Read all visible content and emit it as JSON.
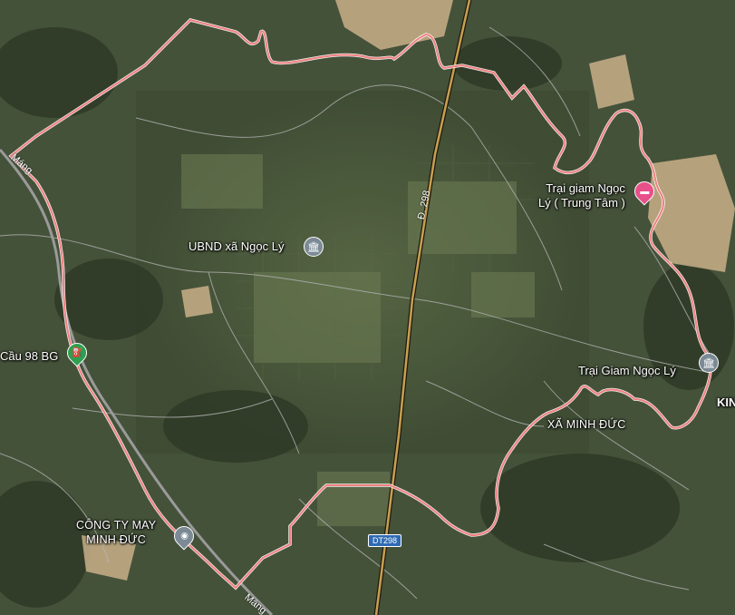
{
  "places": {
    "trai_giam_trung_tam_line1": "Trại giam Ngọc",
    "trai_giam_trung_tam_line2": "Lý ( Trung Tâm )",
    "ubnd": "UBND xã Ngọc Lý",
    "cau98": "Cầu 98 BG",
    "trai_giam": "Trại Giam Ngọc Lý",
    "xa_minh_duc": "XÃ MINH ĐỨC",
    "cong_ty_line1": "CÔNG TY MAY",
    "cong_ty_line2": "MINH ĐỨC",
    "edge_label": "KIN"
  },
  "roads": {
    "d298": "Đ. 298",
    "dt298": "DT298",
    "mang_top": "Máng",
    "mang_bottom": "Máng"
  },
  "colors": {
    "boundary": "#f08080",
    "major_road": "#c8a050",
    "road_line": "#b8b8b8"
  },
  "icons": {
    "gov": "government-building-icon",
    "hotel": "bed-icon",
    "gas": "gas-station-icon",
    "biz": "business-icon"
  }
}
